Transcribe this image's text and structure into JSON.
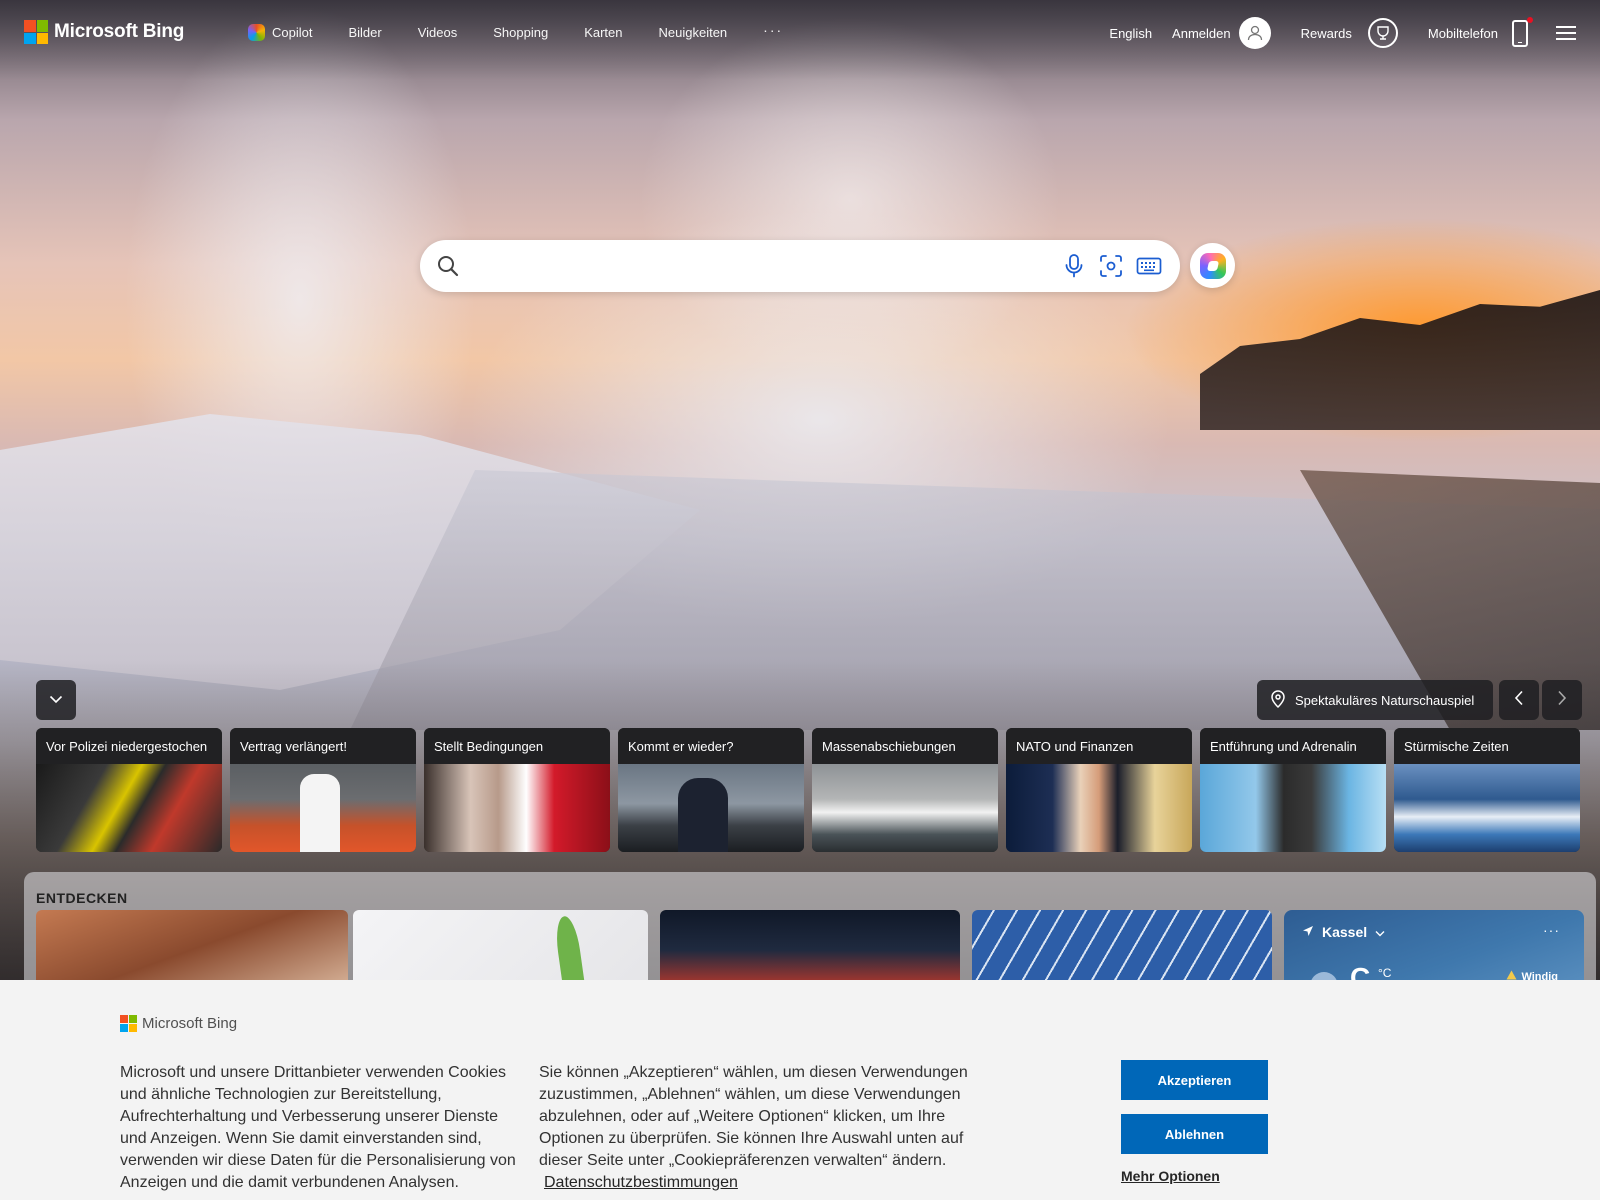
{
  "header": {
    "logo_text": "Microsoft Bing",
    "nav": [
      "Copilot",
      "Bilder",
      "Videos",
      "Shopping",
      "Karten",
      "Neuigkeiten"
    ],
    "more_label": "···",
    "language": "English",
    "signin": "Anmelden",
    "rewards": "Rewards",
    "mobile": "Mobiltelefon"
  },
  "search": {
    "placeholder": "",
    "value": ""
  },
  "hero": {
    "caption": "Spektakuläres Naturschauspiel"
  },
  "news": [
    {
      "title": "Vor Polizei niedergestochen"
    },
    {
      "title": "Vertrag verlängert!"
    },
    {
      "title": "Stellt Bedingungen"
    },
    {
      "title": "Kommt er wieder?"
    },
    {
      "title": "Massenabschiebungen"
    },
    {
      "title": "NATO und Finanzen"
    },
    {
      "title": "Entführung und Adrenalin"
    },
    {
      "title": "Stürmische Zeiten"
    }
  ],
  "discover": {
    "title": "ENTDECKEN",
    "weather": {
      "city": "Kassel",
      "temp": "C",
      "unit": "°C",
      "condition": "Windig",
      "more": "···"
    }
  },
  "cookie": {
    "logo_text": "Microsoft Bing",
    "text1": "Microsoft und unsere Drittanbieter verwenden Cookies und ähnliche Technologien zur Bereitstellung, Aufrechterhaltung und Verbesserung unserer Dienste und Anzeigen. Wenn Sie damit einverstanden sind, verwenden wir diese Daten für die Personalisierung von Anzeigen und die damit verbundenen Analysen.",
    "text2": "Sie können „Akzeptieren“ wählen, um diesen Verwendungen zuzustimmen, „Ablehnen“ wählen, um diese Verwendungen abzulehnen, oder auf „Weitere Optionen“ klicken, um Ihre Optionen zu überprüfen. Sie können Ihre Auswahl unten auf dieser Seite unter „Cookiepräferenzen verwalten“ ändern.",
    "privacy_link": "Datenschutzbestimmungen",
    "accept": "Akzeptieren",
    "reject": "Ablehnen",
    "more": "Mehr Optionen"
  },
  "colors": {
    "ms_red": "#f25022",
    "ms_green": "#7fba00",
    "ms_blue": "#00a4ef",
    "ms_yellow": "#ffb900",
    "button_blue": "#0067b8",
    "icon_blue": "#1b5dd1"
  },
  "icons": [
    "search-icon",
    "microphone-icon",
    "visual-search-icon",
    "keyboard-icon",
    "copilot-icon",
    "user-icon",
    "rewards-icon",
    "phone-icon",
    "menu-icon",
    "chevron-down-icon",
    "location-pin-icon",
    "chevron-left-icon",
    "chevron-right-icon",
    "navigation-arrow-icon",
    "warning-icon"
  ]
}
